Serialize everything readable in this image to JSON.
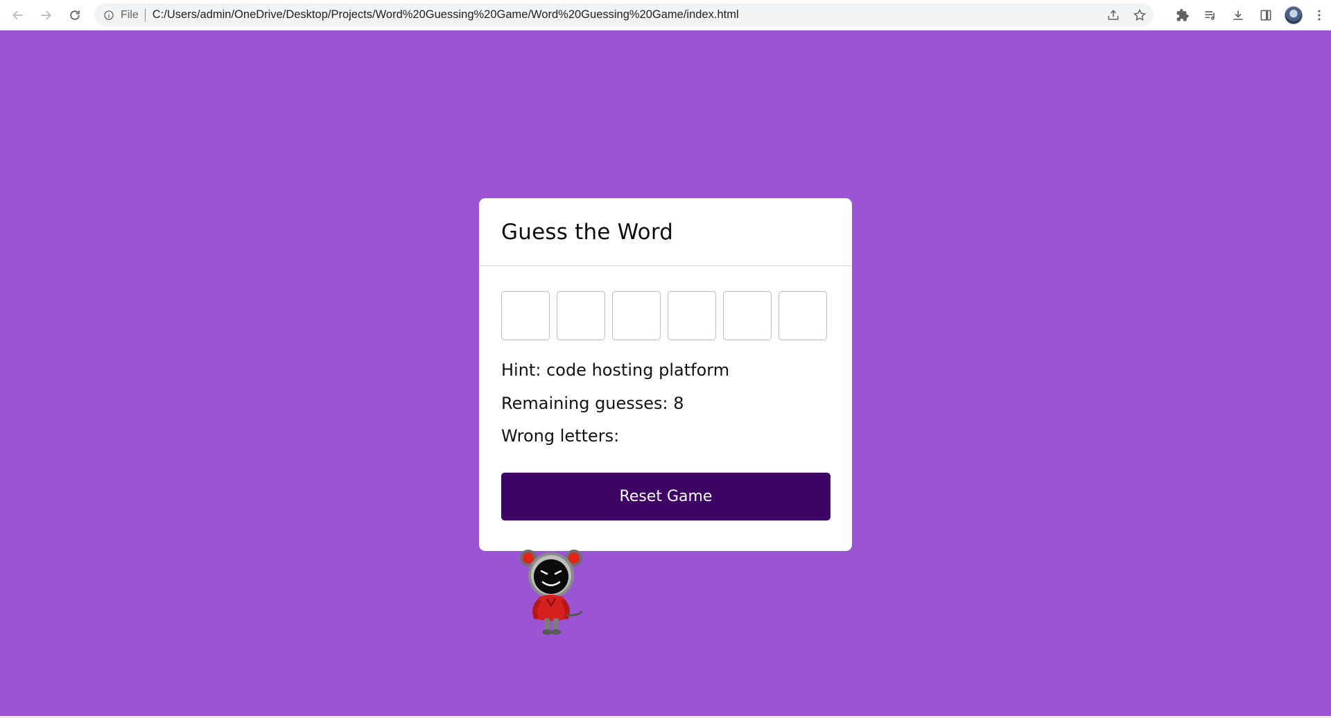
{
  "browser": {
    "file_label": "File",
    "url": "C:/Users/admin/OneDrive/Desktop/Projects/Word%20Guessing%20Game/Word%20Guessing%20Game/index.html"
  },
  "game": {
    "title": "Guess the Word",
    "letter_slots": [
      "",
      "",
      "",
      "",
      "",
      ""
    ],
    "hint_label": "Hint:",
    "hint": "code hosting platform",
    "remaining_label": "Remaining guesses:",
    "remaining": "8",
    "wrong_label": "Wrong letters:",
    "wrong": "",
    "reset_label": "Reset Game"
  },
  "colors": {
    "page_background": "#9b54d3",
    "button_background": "#3d0466",
    "card_background": "#ffffff"
  }
}
